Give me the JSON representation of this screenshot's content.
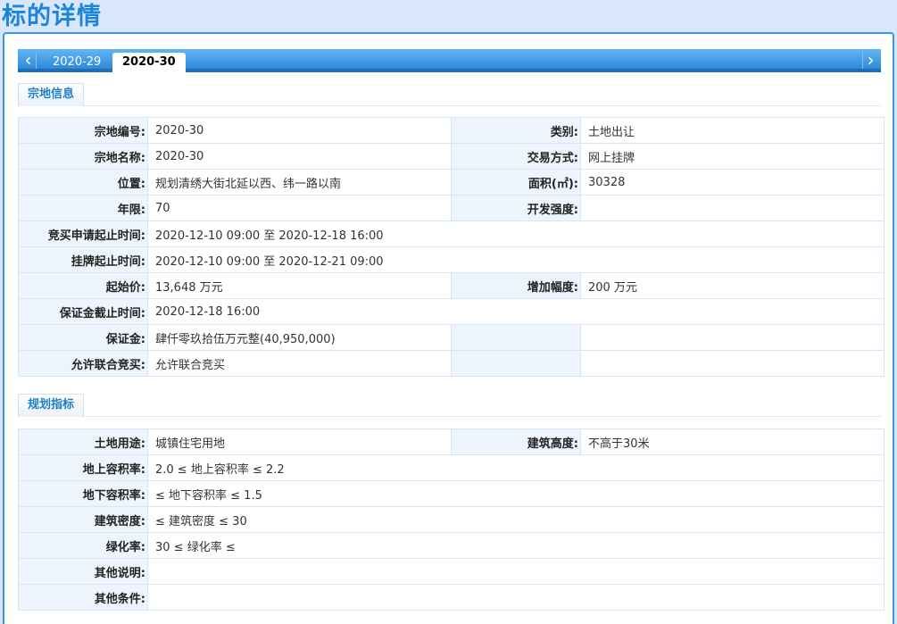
{
  "page": {
    "title": "标的详情"
  },
  "tabs": {
    "prev_icon": "chevron-left-icon",
    "next_icon": "chevron-right-icon",
    "items": [
      {
        "label": "2020-29",
        "active": false
      },
      {
        "label": "2020-30",
        "active": true
      }
    ]
  },
  "parcel": {
    "title": "宗地信息",
    "rows": [
      {
        "label": "宗地编号:",
        "value": "2020-30",
        "label2": "类别:",
        "value2": "土地出让"
      },
      {
        "label": "宗地名称:",
        "value": "2020-30",
        "label2": "交易方式:",
        "value2": "网上挂牌"
      },
      {
        "label": "位置:",
        "value": "规划清绣大街北延以西、纬一路以南",
        "label2": "面积(㎡):",
        "value2": "30328"
      },
      {
        "label": "年限:",
        "value": "70",
        "label2": "开发强度:",
        "value2": ""
      },
      {
        "label": "竞买申请起止时间:",
        "value": "2020-12-10 09:00 至 2020-12-18 16:00"
      },
      {
        "label": "挂牌起止时间:",
        "value": "2020-12-10 09:00 至 2020-12-21 09:00"
      },
      {
        "label": "起始价:",
        "value": "13,648 万元",
        "label2": "增加幅度:",
        "value2": "200 万元"
      },
      {
        "label": "保证金截止时间:",
        "value": "2020-12-18 16:00"
      },
      {
        "label": "保证金:",
        "value": "肆仟零玖拾伍万元整(40,950,000)",
        "label2": "",
        "value2": ""
      },
      {
        "label": "允许联合竞买:",
        "value": "允许联合竞买",
        "label2": "",
        "value2": ""
      }
    ]
  },
  "planning": {
    "title": "规划指标",
    "rows": [
      {
        "label": "土地用途:",
        "value": "城镇住宅用地",
        "label2": "建筑高度:",
        "value2": "不高于30米"
      },
      {
        "label": "地上容积率:",
        "value": "2.0 ≤ 地上容积率 ≤ 2.2"
      },
      {
        "label": "地下容积率:",
        "value": "≤ 地下容积率 ≤ 1.5"
      },
      {
        "label": "建筑密度:",
        "value": "≤ 建筑密度 ≤ 30"
      },
      {
        "label": "绿化率:",
        "value": "30 ≤ 绿化率 ≤"
      },
      {
        "label": "其他说明:",
        "value": ""
      },
      {
        "label": "其他条件:",
        "value": ""
      }
    ]
  },
  "colors": {
    "accent": "#1a86d9",
    "tabbar": "#2d8ad8",
    "label_bg": "#edf4fd",
    "border": "#d6e4f5"
  }
}
